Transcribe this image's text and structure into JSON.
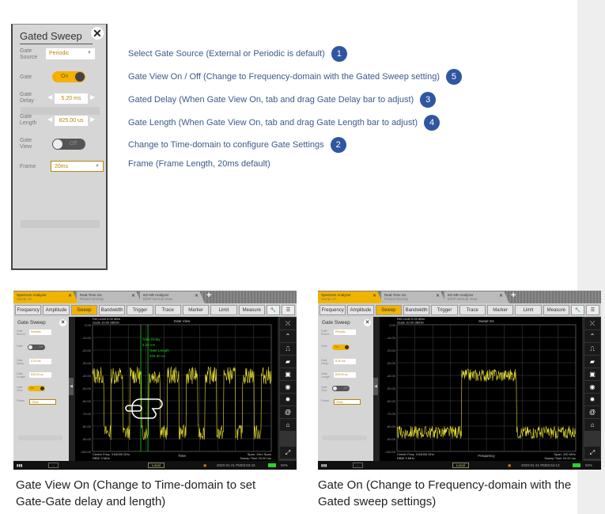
{
  "settings_panel": {
    "title": "Gated Sweep",
    "close_icon": "close-icon",
    "gate_source_label": "Gate Source",
    "gate_source_value": "Periodic",
    "gate_label": "Gate",
    "gate_value": "On",
    "gate_delay_label": "Gate Delay",
    "gate_delay_value": "5.20 ms",
    "gate_length_label": "Gate Length",
    "gate_length_value": "825.00 us",
    "gate_view_label": "Gate View",
    "gate_view_value": "Off",
    "frame_label": "Frame",
    "frame_value": "20ms"
  },
  "annotations": [
    {
      "text": "Select Gate Source (External or Periodic is default)",
      "num": "1"
    },
    {
      "text": "Gate View On / Off (Change to Frequency-domain with the Gated Sweep setting)",
      "num": "5"
    },
    {
      "text": "Gated Delay (When Gate View On, tab and drag Gate Delay bar to adjust)",
      "num": "3"
    },
    {
      "text": "Gate Length (When Gate View On, tab and drag Gate Length bar to adjust)",
      "num": "4"
    },
    {
      "text": "Change to Time-domain to configure Gate Settings",
      "num": "2"
    },
    {
      "text": "Frame (Frame Length, 20ms default)",
      "num": ""
    }
  ],
  "screens": [
    {
      "tabs": [
        {
          "title": "Spectrum Analyzer",
          "sub": "Swept SA"
        },
        {
          "title": "Real-Time SA",
          "sub": "Persist Density"
        },
        {
          "title": "5G-NR Analyzer",
          "sub": "EIRP Normal View"
        }
      ],
      "menu": [
        "Frequency",
        "Amplitude",
        "Sweep",
        "Bandwidth",
        "Trigger",
        "Trace",
        "Marker",
        "Limit",
        "Measure"
      ],
      "panel": {
        "title": "Gate Sweep",
        "source_label": "Gate Source",
        "source": "Periodic",
        "gate_label": "Gate",
        "gate": "Off",
        "delay_label": "Gate Delay",
        "delay": "5.20 ms",
        "length_label": "Gate Length",
        "length": "825.00 us",
        "view_label": "Gate View",
        "view": "On",
        "frame_label": "Frame",
        "frame": "20ms"
      },
      "chart": {
        "title": "Gate View",
        "ref": "Ref Level 0.00 dBm",
        "scale": "Scale 10.00 dB/Div",
        "yticks": [
          "0.00",
          "-10.00",
          "-20.00",
          "-30.00",
          "-40.00",
          "-50.00",
          "-60.00",
          "-70.00",
          "-80.00",
          "-90.00",
          "-100.00"
        ],
        "bl1": "Center Freq: 3.54000 GHz",
        "bl2": "RBW 3 MHz",
        "xlabel": "Time",
        "br1": "Span: Zero Span",
        "br2": "Sweep Time 20.00 ms",
        "gate_delay_label": "Gate Delay",
        "gate_delay": "5.20 ms",
        "gate_length_label": "Gate Length",
        "gate_length": "825.00 us"
      },
      "status": {
        "local": "Local",
        "datetime": "2020-01-21  PM03:53:43",
        "battery": "92%"
      }
    },
    {
      "tabs": [
        {
          "title": "Spectrum Analyzer",
          "sub": "Swept SA"
        },
        {
          "title": "Real-Time SA",
          "sub": "Persist Density"
        },
        {
          "title": "5G-NR Analyzer",
          "sub": "EIRP Normal View"
        }
      ],
      "menu": [
        "Frequency",
        "Amplitude",
        "Sweep",
        "Bandwidth",
        "Trigger",
        "Trace",
        "Marker",
        "Limit",
        "Measure"
      ],
      "panel": {
        "title": "Gate Sweep",
        "source_label": "Gate Source",
        "source": "Periodic",
        "gate_label": "Gate",
        "gate": "On",
        "delay_label": "Gate Delay",
        "delay": "5.20 ms",
        "length_label": "Gate Length",
        "length": "825.00 us",
        "view_label": "Gate View",
        "view": "Off",
        "frame_label": "Frame",
        "frame": "20ms"
      },
      "chart": {
        "title": "Swept SA",
        "ref": "Ref Level 0.00 dBm",
        "scale": "Scale 10.00 dB/Div",
        "yticks": [
          "0.00",
          "-10.00",
          "-20.00",
          "-30.00",
          "-40.00",
          "-50.00",
          "-60.00",
          "-70.00",
          "-80.00",
          "-90.00",
          "-100.00"
        ],
        "bl1": "Center Freq: 3.54000 GHz",
        "bl2": "RBW 3 MHz",
        "xlabel": "Frequency",
        "br1": "Span: 200 MHz",
        "br2": "Sweep Time 20.00 ms"
      },
      "status": {
        "local": "Local",
        "datetime": "2020-01-21  PM03:54:13",
        "battery": "92%"
      }
    }
  ],
  "captions": [
    "Gate View On (Change to Time-domain to set Gate-Gate delay and length)",
    "Gate On (Change to Frequency-domain with the Gated sweep settings)"
  ],
  "colors": {
    "accent": "#f0b400",
    "annotation_badge": "#2f56a0",
    "trace": "#e8e030",
    "gate_line": "#22cc22"
  }
}
